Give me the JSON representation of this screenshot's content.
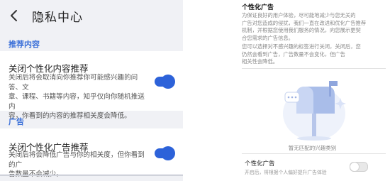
{
  "left_panel": {
    "header": {
      "title": "隐私中心",
      "back_icon": "chevron-left-icon"
    },
    "sections": [
      {
        "label": "推荐内容",
        "item": {
          "title": "关闭个性化内容推荐",
          "desc_lines": [
            "关闭后将会取消向你推荐你可能感兴趣的问答、文",
            "章、课程、书籍等内容，知乎仅向你随机推送内",
            "容，你看到的内容的推荐相关度会降低。"
          ],
          "toggle_on": true
        }
      },
      {
        "label": "广告",
        "item": {
          "title": "关闭个性化广告推荐",
          "desc_lines": [
            "关闭后将会降低广告与你的相关度，但你看到的广",
            "告数量不会减少。"
          ],
          "toggle_on": true
        }
      }
    ],
    "colors": {
      "accent": "#2d62d9",
      "section_label": "#3a6fd8",
      "background": "#f0f1f5"
    }
  },
  "right_panel": {
    "title": "个性化广告",
    "para1_lines": [
      "为保证良好的用户体验，尽可能地减少与您无关的",
      "广告对您造成的侵扰，我们一直在改进和优化广告推荐",
      "机制，并根据您使用我们服务的情况，向您展示更契",
      "合您需求的广告信息。"
    ],
    "para2_lines": [
      "您可以选择对不感兴趣的标签进行关闭，关闭后，您",
      "仍然会看到广告，广告数量不会变化，但广告",
      "相关性会降低。"
    ],
    "empty_caption": "暂无匹配的兴趣类别",
    "illustration_icon": "mailbox-icon",
    "option": {
      "title": "个性化广告",
      "desc": "开启后，将根据个人偏好提升广告体验",
      "toggle_on": false
    }
  }
}
